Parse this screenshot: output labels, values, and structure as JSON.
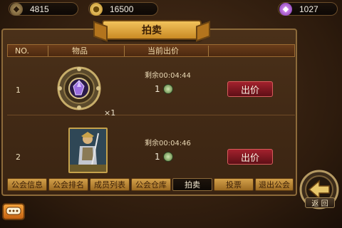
{
  "topbar": {
    "silver": "4815",
    "gold": "16500",
    "diamond": "1027"
  },
  "panel": {
    "title": "拍卖",
    "headers": {
      "no": "NO.",
      "item": "物品",
      "price": "当前出价"
    }
  },
  "rows": [
    {
      "no": "1",
      "remain": "剩余00:04:44",
      "bid": "1",
      "qty": "×1",
      "button": "出价"
    },
    {
      "no": "2",
      "remain": "剩余00:04:46",
      "bid": "1",
      "button": "出价"
    }
  ],
  "tabs": [
    "公会信息",
    "公会排名",
    "成员列表",
    "公会仓库",
    "拍卖",
    "投票",
    "退出公会"
  ],
  "active_tab": "拍卖",
  "back_label": "返 回",
  "icons": {
    "silver": "silver-coin-icon",
    "gold": "gold-coin-icon",
    "diamond": "diamond-icon",
    "chat": "chat-bubble-icon",
    "back": "back-arrow-icon"
  }
}
